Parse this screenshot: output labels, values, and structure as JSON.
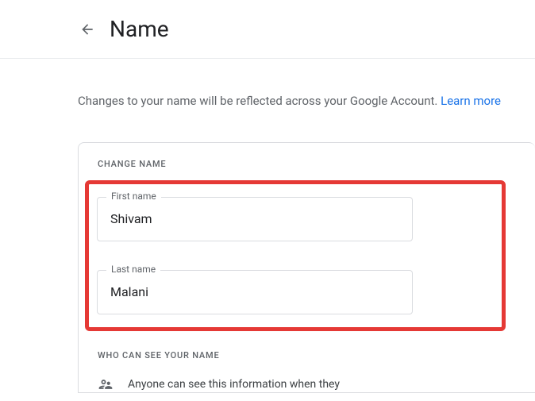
{
  "header": {
    "title": "Name"
  },
  "description": {
    "text": "Changes to your name will be reflected across your Google Account. ",
    "learn_more": "Learn more"
  },
  "form": {
    "section_label": "CHANGE NAME",
    "first_name_label": "First name",
    "first_name_value": "Shivam",
    "last_name_label": "Last name",
    "last_name_value": "Malani"
  },
  "visibility": {
    "section_label": "WHO CAN SEE YOUR NAME",
    "text": "Anyone can see this information when they"
  }
}
